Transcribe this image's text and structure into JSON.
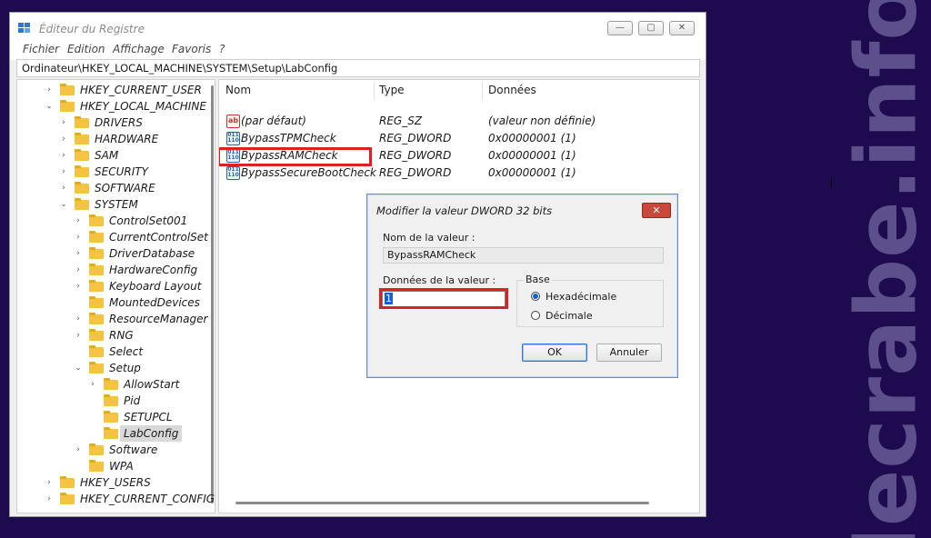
{
  "watermark": "lecrabe.info",
  "window": {
    "title": "Éditeur du Registre",
    "buttons": {
      "minimize": "—",
      "maximize": "▢",
      "close": "✕"
    }
  },
  "menu": [
    "Fichier",
    "Edition",
    "Affichage",
    "Favoris",
    "?"
  ],
  "address": "Ordinateur\\HKEY_LOCAL_MACHINE\\SYSTEM\\Setup\\LabConfig",
  "tree": [
    {
      "label": "HKEY_CURRENT_USER",
      "chevron": "›",
      "level": 0
    },
    {
      "label": "HKEY_LOCAL_MACHINE",
      "chevron": "⌄",
      "level": 0
    },
    {
      "label": "DRIVERS",
      "chevron": "›",
      "level": 1
    },
    {
      "label": "HARDWARE",
      "chevron": "›",
      "level": 1
    },
    {
      "label": "SAM",
      "chevron": "›",
      "level": 1
    },
    {
      "label": "SECURITY",
      "chevron": "›",
      "level": 1
    },
    {
      "label": "SOFTWARE",
      "chevron": "›",
      "level": 1
    },
    {
      "label": "SYSTEM",
      "chevron": "⌄",
      "level": 1
    },
    {
      "label": "ControlSet001",
      "chevron": "›",
      "level": 2
    },
    {
      "label": "CurrentControlSet",
      "chevron": "›",
      "level": 2
    },
    {
      "label": "DriverDatabase",
      "chevron": "›",
      "level": 2
    },
    {
      "label": "HardwareConfig",
      "chevron": "›",
      "level": 2
    },
    {
      "label": "Keyboard Layout",
      "chevron": "›",
      "level": 2
    },
    {
      "label": "MountedDevices",
      "chevron": "",
      "level": 2
    },
    {
      "label": "ResourceManager",
      "chevron": "›",
      "level": 2
    },
    {
      "label": "RNG",
      "chevron": "›",
      "level": 2
    },
    {
      "label": "Select",
      "chevron": "",
      "level": 2
    },
    {
      "label": "Setup",
      "chevron": "⌄",
      "level": 2
    },
    {
      "label": "AllowStart",
      "chevron": "›",
      "level": 3
    },
    {
      "label": "Pid",
      "chevron": "",
      "level": 3
    },
    {
      "label": "SETUPCL",
      "chevron": "",
      "level": 3
    },
    {
      "label": "LabConfig",
      "chevron": "",
      "level": 3,
      "selected": true
    },
    {
      "label": "Software",
      "chevron": "›",
      "level": 2
    },
    {
      "label": "WPA",
      "chevron": "",
      "level": 2
    },
    {
      "label": "HKEY_USERS",
      "chevron": "›",
      "level": 0
    },
    {
      "label": "HKEY_CURRENT_CONFIG",
      "chevron": "›",
      "level": 0
    }
  ],
  "values": {
    "columns": {
      "name": "Nom",
      "type": "Type",
      "data": "Données"
    },
    "rows": [
      {
        "name": "(par défaut)",
        "type": "REG_SZ",
        "data": "(valeur non définie)",
        "icon": "string-value-icon"
      },
      {
        "name": "BypassTPMCheck",
        "type": "REG_DWORD",
        "data": "0x00000001 (1)",
        "icon": "binary-value-icon"
      },
      {
        "name": "BypassRAMCheck",
        "type": "REG_DWORD",
        "data": "0x00000001 (1)",
        "icon": "binary-value-icon",
        "highlighted": true
      },
      {
        "name": "BypassSecureBootCheck",
        "type": "REG_DWORD",
        "data": "0x00000001 (1)",
        "icon": "binary-value-icon"
      }
    ]
  },
  "dialog": {
    "title": "Modifier la valeur DWORD 32 bits",
    "close": "✕",
    "name_label": "Nom de la valeur :",
    "name_value": "BypassRAMCheck",
    "data_label": "Données de la valeur :",
    "data_value": "1",
    "base_label": "Base",
    "hex_label": "Hexadécimale",
    "dec_label": "Décimale",
    "ok": "OK",
    "cancel": "Annuler"
  },
  "colors": {
    "highlight": "#e02020",
    "accent": "#0a64d8",
    "background": "#1e0a4f"
  }
}
